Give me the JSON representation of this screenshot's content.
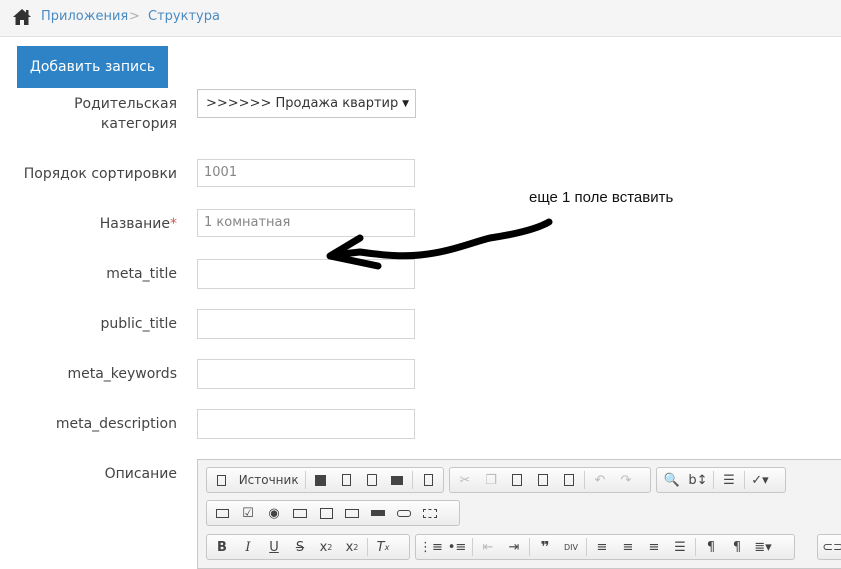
{
  "breadcrumb": {
    "items": [
      "Приложения",
      "Структура"
    ],
    "separator": ">"
  },
  "actions": {
    "add_button": "Добавить запись"
  },
  "form": {
    "parent_category": {
      "label_line1": "Родительская",
      "label_line2": "категория",
      "value": ">>>>>> Продажа квартир"
    },
    "sort_order": {
      "label": "Порядок сортировки",
      "value": "1001"
    },
    "name": {
      "label": "Название",
      "required_mark": "*",
      "value": "1 комнатная"
    },
    "meta_title": {
      "label": "meta_title",
      "value": ""
    },
    "public_title": {
      "label": "public_title",
      "value": ""
    },
    "meta_keywords": {
      "label": "meta_keywords",
      "value": ""
    },
    "meta_description": {
      "label": "meta_description",
      "value": ""
    },
    "description": {
      "label": "Описание"
    }
  },
  "annotation": {
    "text": "еще 1 поле вставить"
  },
  "editor": {
    "source_label": "Источник",
    "icons_row1": [
      "source-icon",
      "save-icon",
      "new-page-icon",
      "preview-icon",
      "print-icon",
      "templates-icon",
      "cut-icon",
      "copy-icon",
      "paste-icon",
      "paste-text-icon",
      "paste-word-icon",
      "undo-icon",
      "redo-icon",
      "find-icon",
      "replace-icon",
      "select-all-icon",
      "spellcheck-icon"
    ],
    "icons_row2": [
      "form-icon",
      "checkbox-icon",
      "radio-icon",
      "textfield-icon",
      "textarea-icon",
      "select-icon",
      "button-icon",
      "image-button-icon",
      "hidden-field-icon"
    ],
    "icons_row3": [
      "bold-icon",
      "italic-icon",
      "underline-icon",
      "strike-icon",
      "subscript-icon",
      "superscript-icon",
      "remove-format-icon",
      "numbered-list-icon",
      "bulleted-list-icon",
      "outdent-icon",
      "indent-icon",
      "blockquote-icon",
      "div-icon",
      "align-left-icon",
      "align-center-icon",
      "align-right-icon",
      "justify-icon",
      "ltr-icon",
      "rtl-icon",
      "language-icon",
      "link-icon"
    ]
  },
  "colors": {
    "accent": "#2d83c5",
    "link": "#4a8bc2",
    "required": "#d15b47"
  }
}
